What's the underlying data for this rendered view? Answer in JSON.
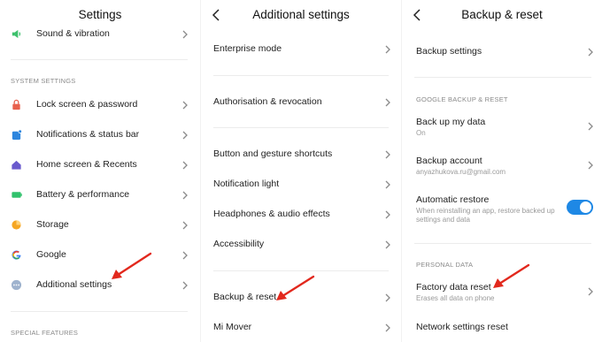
{
  "panel1": {
    "title": "Settings",
    "top_item": {
      "label": "Sound & vibration",
      "icon": "speaker-icon",
      "color": "#3ec16d"
    },
    "section_system": "SYSTEM SETTINGS",
    "items": [
      {
        "label": "Lock screen & password",
        "icon": "lock-icon",
        "color": "#e8604c"
      },
      {
        "label": "Notifications & status bar",
        "icon": "notification-icon",
        "color": "#2e86de"
      },
      {
        "label": "Home screen & Recents",
        "icon": "home-icon",
        "color": "#6a5acd"
      },
      {
        "label": "Battery & performance",
        "icon": "battery-icon",
        "color": "#32c26d"
      },
      {
        "label": "Storage",
        "icon": "storage-pie-icon",
        "color": "#f5a623"
      },
      {
        "label": "Google",
        "icon": "google-icon",
        "color": "#4285f4"
      },
      {
        "label": "Additional settings",
        "icon": "more-dots-icon",
        "color": "#9fb3ce"
      }
    ],
    "section_special": "SPECIAL FEATURES"
  },
  "panel2": {
    "title": "Additional settings",
    "items": [
      {
        "label": "Enterprise mode"
      },
      {
        "label": "Authorisation & revocation"
      },
      {
        "label": "Button and gesture shortcuts"
      },
      {
        "label": "Notification light"
      },
      {
        "label": "Headphones & audio effects"
      },
      {
        "label": "Accessibility"
      },
      {
        "label": "Backup & reset"
      },
      {
        "label": "Mi Mover"
      }
    ]
  },
  "panel3": {
    "title": "Backup & reset",
    "backup_settings": "Backup settings",
    "section_google": "GOOGLE BACKUP & RESET",
    "backup_my_data": {
      "label": "Back up my data",
      "sub": "On"
    },
    "backup_account": {
      "label": "Backup account",
      "sub": "anyazhukova.ru@gmail.com"
    },
    "automatic_restore": {
      "label": "Automatic restore",
      "sub1": "When reinstalling an app, restore backed up",
      "sub2": "settings and data",
      "enabled": true
    },
    "section_personal": "PERSONAL DATA",
    "factory_reset": {
      "label": "Factory data reset",
      "sub": "Erases all data on phone"
    },
    "network_reset": "Network settings reset"
  },
  "colors": {
    "accent": "#1e88e5",
    "annotation_arrow": "#e2281d"
  }
}
